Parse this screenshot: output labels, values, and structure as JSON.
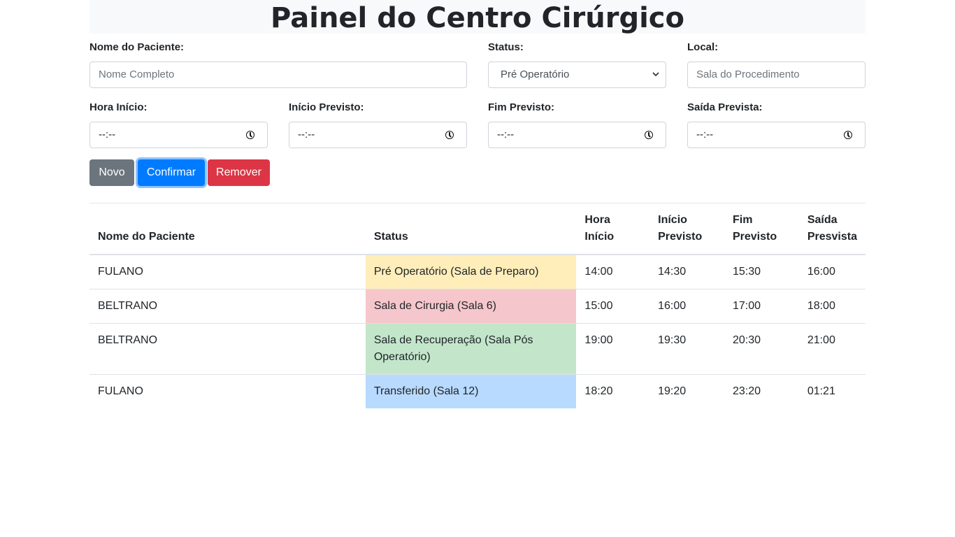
{
  "page_title": "Painel do Centro Cirúrgico",
  "form": {
    "patient_name": {
      "label": "Nome do Paciente:",
      "placeholder": "Nome Completo"
    },
    "status": {
      "label": "Status:",
      "selected": "Pré Operatório"
    },
    "location": {
      "label": "Local:",
      "placeholder": "Sala do Procedimento"
    },
    "start_time": {
      "label": "Hora Início:",
      "value": "--:--"
    },
    "expected_start": {
      "label": "Início Previsto:",
      "value": "--:--"
    },
    "expected_end": {
      "label": "Fim Previsto:",
      "value": "--:--"
    },
    "expected_exit": {
      "label": "Saída Prevista:",
      "value": "--:--"
    }
  },
  "buttons": {
    "new": "Novo",
    "confirm": "Confirmar",
    "remove": "Remover"
  },
  "table": {
    "headers": {
      "name": "Nome do Paciente",
      "status": "Status",
      "start": "Hora Início",
      "expected_start": "Início Previsto",
      "expected_end": "Fim Previsto",
      "exit": "Saída Presvista"
    },
    "rows": [
      {
        "name": "FULANO",
        "status": "Pré Operatório (Sala de Preparo)",
        "start": "14:00",
        "expected_start": "14:30",
        "expected_end": "15:30",
        "exit": "16:00"
      },
      {
        "name": "BELTRANO",
        "status": "Sala de Cirurgia (Sala 6)",
        "start": "15:00",
        "expected_start": "16:00",
        "expected_end": "17:00",
        "exit": "18:00"
      },
      {
        "name": "BELTRANO",
        "status": "Sala de Recuperação (Sala Pós Operatório)",
        "start": "19:00",
        "expected_start": "19:30",
        "expected_end": "20:30",
        "exit": "21:00"
      },
      {
        "name": "FULANO",
        "status": "Transferido (Sala 12)",
        "start": "18:20",
        "expected_start": "19:20",
        "expected_end": "23:20",
        "exit": "01:21"
      }
    ]
  },
  "colors": {
    "pre_op": "#ffeeba",
    "surgery": "#f5c6cb",
    "recovery": "#c3e6cb",
    "transferred": "#b8daff",
    "btn_new": "#6c757d",
    "btn_confirm": "#007bff",
    "btn_remove": "#dc3545"
  },
  "icons": {
    "time_field": "clock-icon",
    "select": "chevron-down-icon"
  }
}
